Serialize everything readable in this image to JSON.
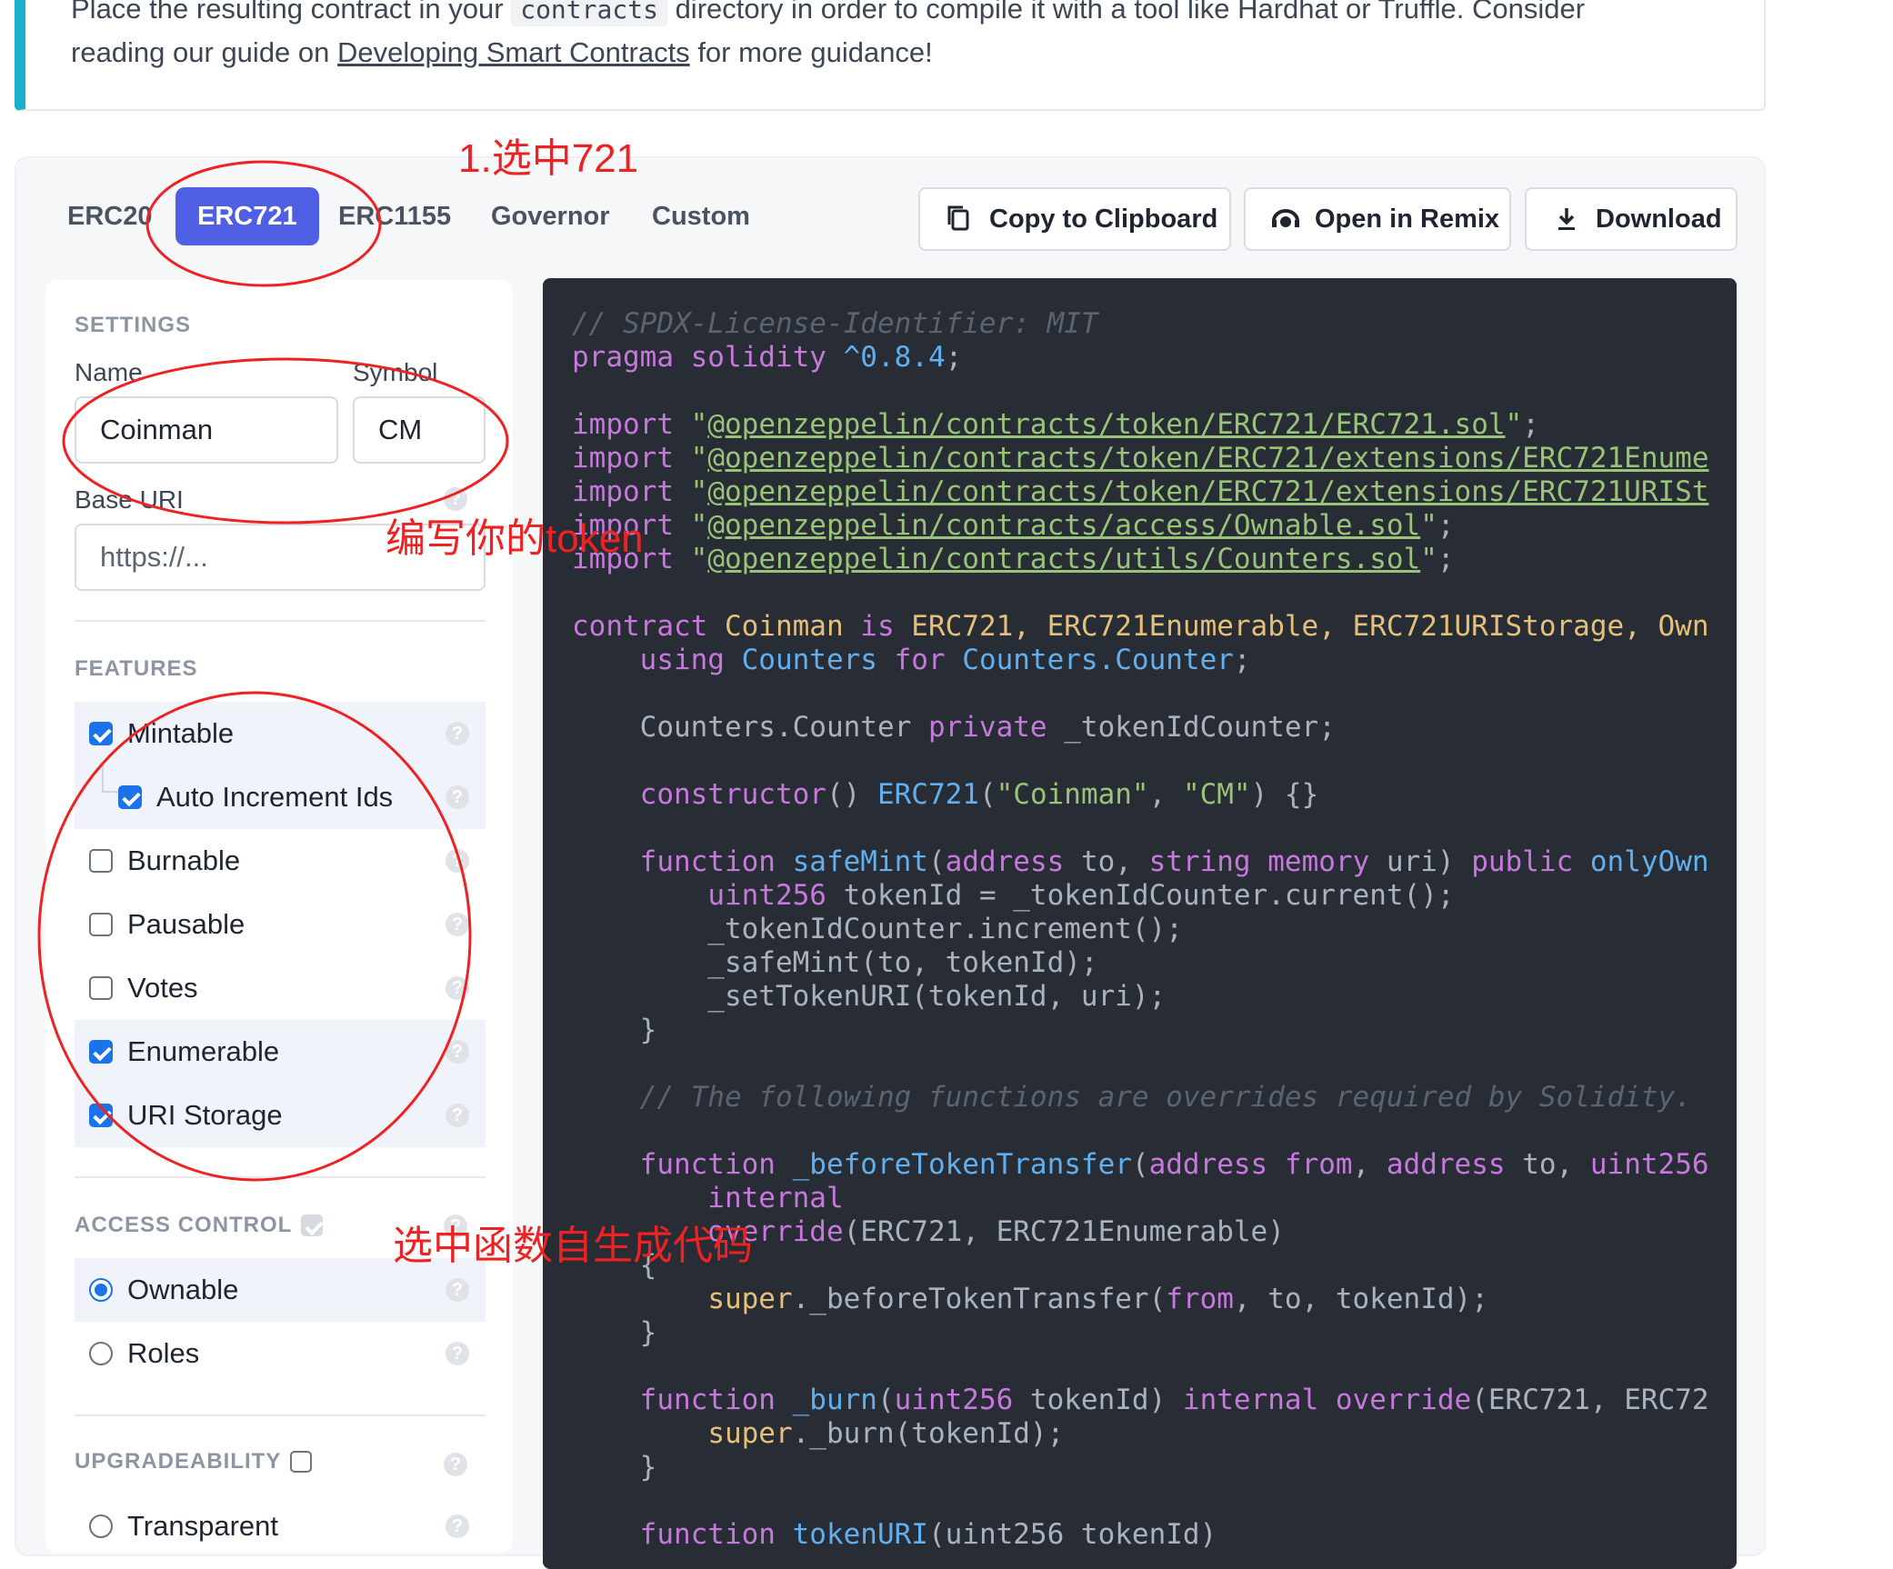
{
  "info": {
    "line1_pre": "Place the resulting contract in your",
    "line1_code": "contracts",
    "line1_post": "directory in order to compile it with a tool like Hardhat or Truffle. Consider",
    "line2_pre": "reading our guide on",
    "line2_link": "Developing Smart Contracts",
    "line2_post": "for more guidance!"
  },
  "tabs": [
    "ERC20",
    "ERC721",
    "ERC1155",
    "Governor",
    "Custom"
  ],
  "active_tab": "ERC721",
  "actions": {
    "copy": "Copy to Clipboard",
    "remix": "Open in Remix",
    "download": "Download"
  },
  "settings": {
    "title": "SETTINGS",
    "name_label": "Name",
    "name_value": "Coinman",
    "symbol_label": "Symbol",
    "symbol_value": "CM",
    "base_uri_label": "Base URI",
    "base_uri_placeholder": "https://..."
  },
  "features": {
    "title": "FEATURES",
    "items": [
      {
        "label": "Mintable",
        "checked": true
      },
      {
        "label": "Auto Increment Ids",
        "checked": true
      },
      {
        "label": "Burnable",
        "checked": false
      },
      {
        "label": "Pausable",
        "checked": false
      },
      {
        "label": "Votes",
        "checked": false
      },
      {
        "label": "Enumerable",
        "checked": true
      },
      {
        "label": "URI Storage",
        "checked": true
      }
    ]
  },
  "access_control": {
    "title": "ACCESS CONTROL",
    "enabled": true,
    "options": [
      {
        "label": "Ownable",
        "selected": true
      },
      {
        "label": "Roles",
        "selected": false
      }
    ]
  },
  "upgradeability": {
    "title": "UPGRADEABILITY",
    "enabled": false,
    "options": [
      {
        "label": "Transparent",
        "selected": false
      }
    ]
  },
  "help_glyph": "?",
  "code": {
    "l1": "// SPDX-License-Identifier: MIT",
    "pragma_kw": "pragma",
    "pragma_mid": " solidity ",
    "pragma_ver": "^0.8.4",
    "semi": ";",
    "import_kw": "import",
    "q": "\"",
    "imp1": "@openzeppelin/contracts/token/ERC721/ERC721.sol",
    "imp2": "@openzeppelin/contracts/token/ERC721/extensions/ERC721Enume",
    "imp3": "@openzeppelin/contracts/token/ERC721/extensions/ERC721URISt",
    "imp4": "@openzeppelin/contracts/access/Ownable.sol",
    "imp5": "@openzeppelin/contracts/utils/Counters.sol",
    "contract_kw": "contract",
    "contract_name": " Coinman ",
    "is_kw": "is",
    "bases": " ERC721, ERC721Enumerable, ERC721URIStorage, Own",
    "using_kw": "    using",
    "counters1": " Counters ",
    "for_kw": "for",
    "counters2": " Counters.Counter",
    "counter_decl_a": "    Counters.Counter ",
    "private_kw": "private",
    "counter_decl_b": " _tokenIdCounter;",
    "ctor_kw": "    constructor",
    "ctor_a": "() ",
    "ctor_base": "ERC721",
    "ctor_b": "(",
    "ctor_s1": "\"Coinman\"",
    "ctor_c": ", ",
    "ctor_s2": "\"CM\"",
    "ctor_d": ") {}",
    "fn_kw": "    function",
    "fn1_name": " safeMint",
    "fn1_a": "(",
    "address_kw": "address",
    "fn1_b": " to, ",
    "string_kw": "string",
    "sp": " ",
    "memory_kw": "memory",
    "fn1_c": " uri) ",
    "public_kw": "public",
    "fn1_mod": " onlyOwn",
    "fn1_l1a": "        ",
    "uint_kw": "uint256",
    "fn1_l1b": " tokenId = _tokenIdCounter.current();",
    "fn1_l2": "        _tokenIdCounter.increment();",
    "fn1_l3": "        _safeMint(to, tokenId);",
    "fn1_l4": "        _setTokenURI(tokenId, uri);",
    "close": "    }",
    "comment2": "    // The following functions are overrides required by Solidity.",
    "fn2_name": " _beforeTokenTransfer",
    "fn2_a": "(",
    "from_kw": "from",
    "fn2_b": ", ",
    "fn2_c": " to, ",
    "uint_trunc": "uint256",
    "internal_l": "        internal",
    "override_l_a": "        ",
    "override_kw": "override",
    "override_l_b": "(ERC721, ERC721Enumerable)",
    "open_brace": "    {",
    "super_l_a": "        ",
    "super_kw": "super",
    "super2_b": "._beforeTokenTransfer(",
    "super2_c": ", to, tokenId);",
    "fn3_name": " _burn",
    "fn3_a": "(",
    "fn3_b": " tokenId) ",
    "internal_kw": "internal",
    "fn3_c": "(ERC721, ERC72",
    "super3_b": "._burn(tokenId);",
    "fn4_name": " tokenURI",
    "fn4_a": "(uint256 tokenId)"
  },
  "annotations": {
    "select_721": "1.选中721",
    "write_token": "编写你的token",
    "select_funcs": "选中函数自生成代码"
  },
  "colors": {
    "accent": "#4f5fe3",
    "info_bar": "#18b1c9",
    "annotation": "#ee2222",
    "code_bg": "#282c34"
  }
}
